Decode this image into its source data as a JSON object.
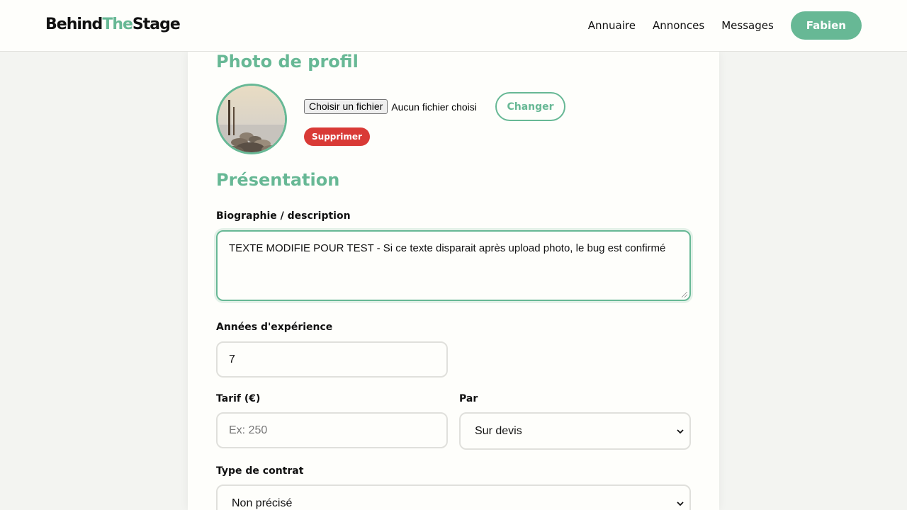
{
  "brand": {
    "part1": "Behind",
    "part2": "The",
    "part3": "Stage"
  },
  "nav": {
    "directory": "Annuaire",
    "ads": "Annonces",
    "messages": "Messages",
    "user": "Fabien"
  },
  "colors": {
    "accent": "#67b895",
    "danger": "#d93a36"
  },
  "photo": {
    "title": "Photo de profil",
    "file_button": "Choisir un fichier",
    "file_status": "Aucun fichier choisi",
    "change": "Changer",
    "delete": "Supprimer"
  },
  "presentation": {
    "title": "Présentation",
    "bio_label": "Biographie / description",
    "bio_value": "TEXTE MODIFIE POUR TEST - Si ce texte disparait après upload photo, le bug est confirmé",
    "experience_label": "Années d'expérience",
    "experience_value": "7",
    "rate_label": "Tarif (€)",
    "rate_placeholder": "Ex: 250",
    "per_label": "Par",
    "per_value": "Sur devis",
    "contract_label": "Type de contrat",
    "contract_value": "Non précisé"
  }
}
